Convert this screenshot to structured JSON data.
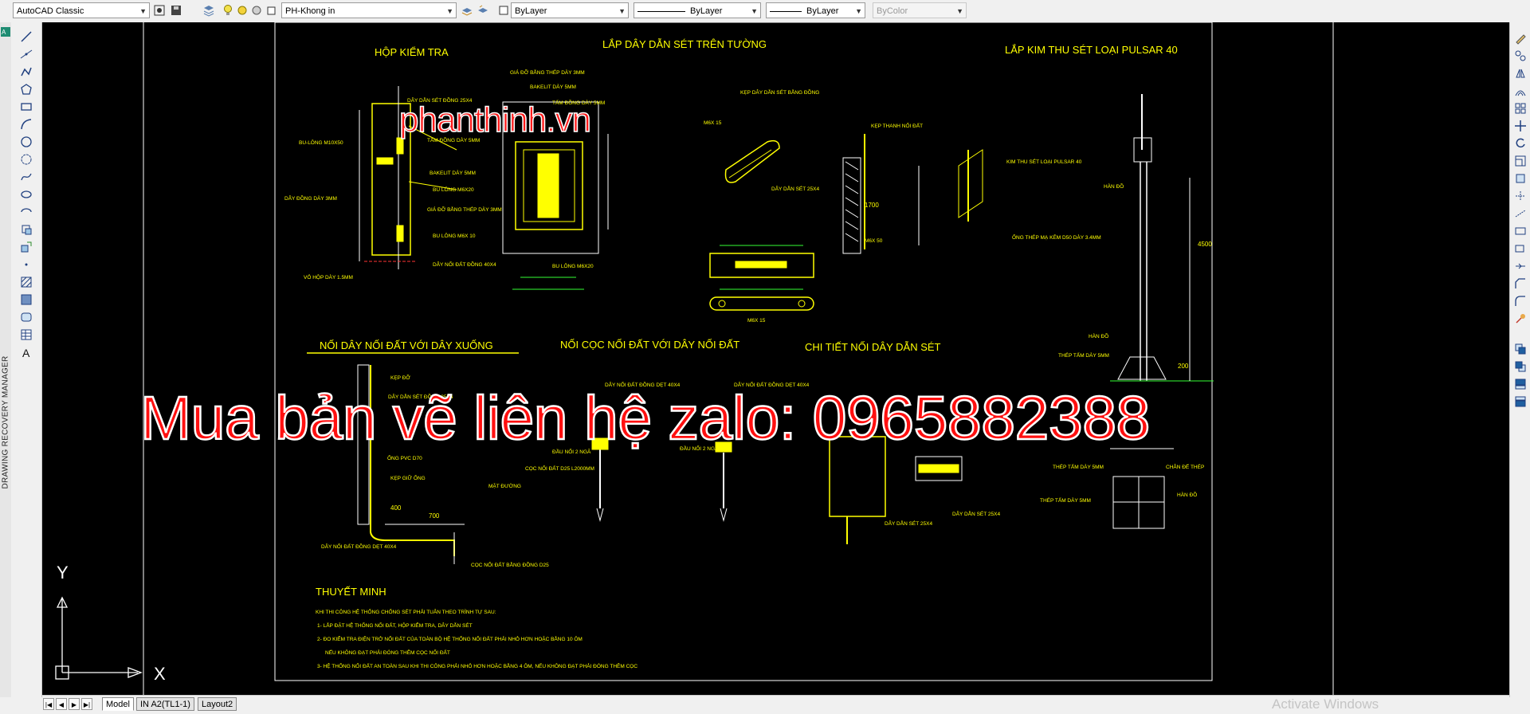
{
  "toolbar": {
    "workspace": "AutoCAD Classic",
    "layer": "PH-Khong in",
    "color": "ByLayer",
    "linetype": "ByLayer",
    "lineweight": "ByLayer",
    "plotstyle": "ByColor"
  },
  "side_panel": {
    "label": "DRAWING RECOVERY MANAGER"
  },
  "drawing": {
    "watermark_site": "phanthinh.vn",
    "watermark_buy": "Mua bản vẽ liên hệ zalo: 0965882388",
    "sections": {
      "test_box": "HỘP KIỂM TRA",
      "wall_install": "LẮP DÂY DẪN SÉT TRÊN TƯỜNG",
      "pulsar": "LẮP KIM THU SÉT LOẠI PULSAR 40",
      "ground_down": "NỐI DÂY NỐI ĐẤT VỚI DÂY XUỐNG",
      "rod_wire": "NỐI CỌC NỐI ĐẤT VỚI DÂY NỐI ĐẤT",
      "detail": "CHI TIẾT NỐI DÂY DẪN SÉT",
      "notes_title": "THUYẾT MINH"
    },
    "labels": {
      "bulong_m10x50": "BU-LÔNG M10X50",
      "day_dot_dong": "DÂY ĐỒNG DÀY 3MM",
      "vo_hop": "VỎ HỘP DÀY 1.5MM",
      "day_dan_set_25": "DÂY DẪN SÉT ĐỒNG 25X4",
      "tam_dong": "TẤM ĐỒNG DÀY 5MM",
      "bakelit": "BAKELIT DÀY 5MM",
      "bulong_m6x20": "BU LÔNG M6X20",
      "gia_do": "GIÁ ĐỠ BẰNG THÉP DÀY 3MM",
      "bulong_m6x10": "BU LÔNG M6X 10",
      "day_noi_dat": "DÂY NỐI ĐẤT ĐỒNG 40X4",
      "kep_day_dan": "KẸP DÂY DẪN SÉT BẰNG ĐỒNG",
      "m6x15": "M6X 15",
      "day_dan_set_25x4": "DÂY DẪN SÉT 25X4",
      "kep_thanh": "KẸP THANH NỐI ĐẤT",
      "dim_1700": "1700",
      "m6x50": "M6X 50",
      "kim_thu": "KIM THU SÉT LOẠI PULSAR 40",
      "han_do": "HÀN ĐỒ",
      "ong_thep": "ỐNG THÉP MẠ KẼM D50 DÀY 3.4MM",
      "dim_4500": "4500",
      "dim_200": "200",
      "thep_tam": "THÉP TẤM DÀY 5MM",
      "chan_de": "CHÂN ĐẾ THÉP",
      "kep_do": "KẸP ĐỠ",
      "ong_pvc": "ỐNG PVC D70",
      "kep_giu": "KẸP GIỮ ỐNG",
      "mat_duong": "MẶT ĐƯỜNG",
      "dim_400": "400",
      "dim_700": "700",
      "coc_noi_dat": "CỌC NỐI ĐẤT BẰNG ĐỒNG D25",
      "day_noi_dat_40": "DÂY NỐI ĐẤT ĐỒNG DẸT 40X4",
      "dau_noi": "ĐẦU NỐI 2 NGÃ",
      "coc_l2000": "CỌC NỐI ĐẤT D25 L2000MM"
    },
    "notes": [
      "KHI THI CÔNG HỆ THỐNG CHỐNG SÉT PHẢI TUÂN THEO TRÌNH TỰ SAU:",
      "1- LẮP ĐẶT HỆ THỐNG NỐI ĐẤT, HỘP KIỂM TRA, DÂY DẪN SÉT",
      "2- ĐO KIỂM TRA ĐIỆN TRỞ NỐI ĐẤT CỦA TOÀN BỘ HỆ THỐNG NỐI ĐẤT PHẢI NHỎ HƠN HOẶC BẰNG 10 ÔM",
      "NẾU KHÔNG ĐẠT PHẢI ĐÓNG THÊM CỌC NỐI ĐẤT",
      "3- HỆ THỐNG NỐI ĐẤT AN TOÀN SAU KHI THI CÔNG PHẢI NHỎ HƠN HOẶC BẰNG 4 ÔM, NẾU KHÔNG ĐẠT PHẢI ĐÓNG THÊM CỌC"
    ],
    "ucs": {
      "x": "X",
      "y": "Y"
    }
  },
  "tabs": {
    "model": "Model",
    "layout1": "IN A2(TL1-1)",
    "layout2": "Layout2"
  },
  "os_watermark": "Activate Windows",
  "colors": {
    "canvas": "#000000",
    "geometry": "#ffff00",
    "watermark": "#ff1a1a"
  }
}
